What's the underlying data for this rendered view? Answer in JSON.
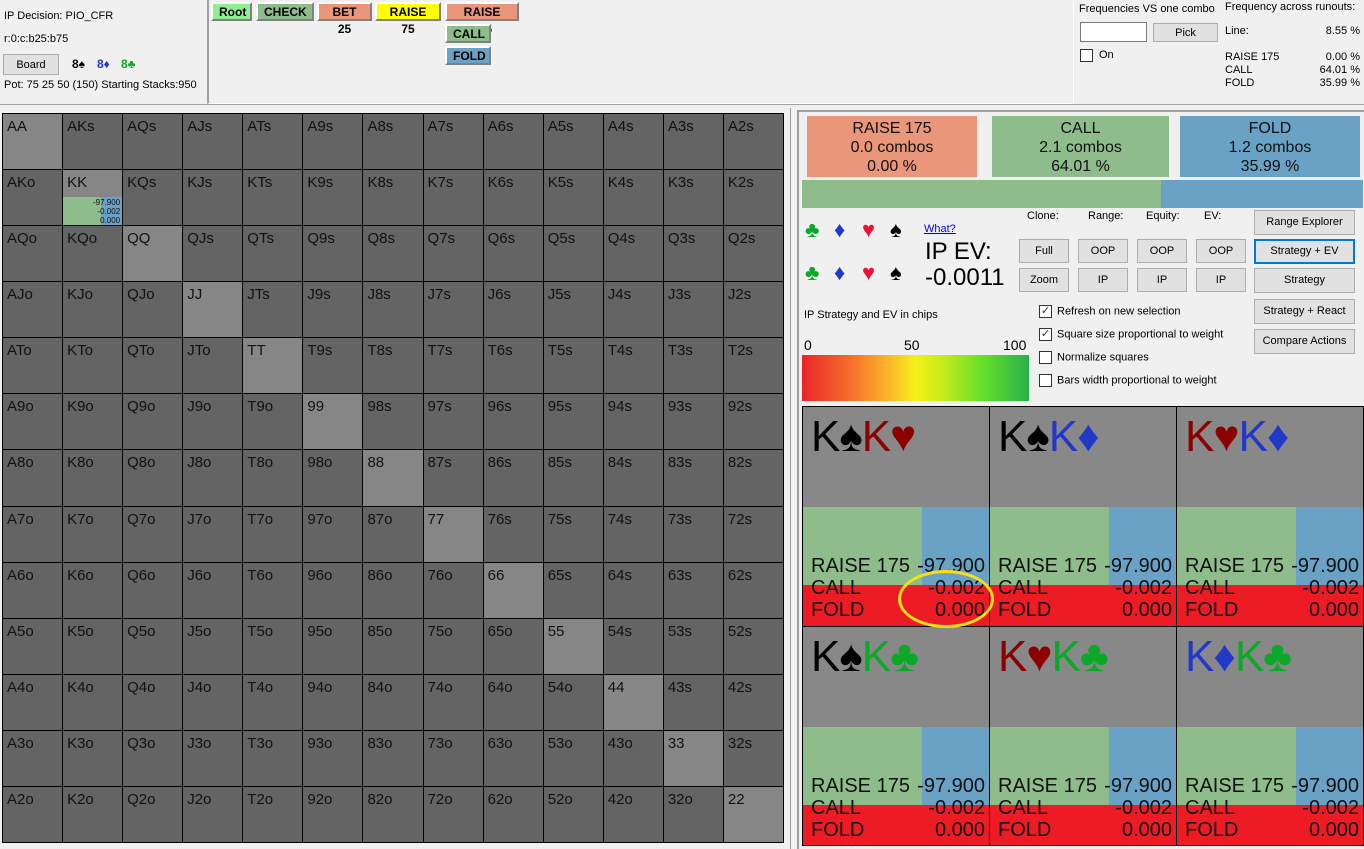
{
  "info": {
    "decision": "IP Decision:  PIO_CFR",
    "line": "r:0:c:b25:b75",
    "board_button": "Board",
    "board_cards": [
      {
        "text": "8♠",
        "suit": "spade"
      },
      {
        "text": "8♦",
        "suit": "diamond"
      },
      {
        "text": "8♣",
        "suit": "club"
      }
    ],
    "pot": "Pot: 75 25 50 (150) Starting Stacks:950"
  },
  "tree": {
    "nodes": [
      {
        "label": "Root",
        "color": "#90ee90"
      },
      {
        "label": "CHECK",
        "color": "#8fbc8b"
      },
      {
        "label": "BET 25",
        "color": "#e9967a"
      },
      {
        "label": "RAISE 75",
        "color": "#ffff00"
      },
      {
        "label": "RAISE 175",
        "color": "#e9967a"
      },
      {
        "label": "CALL",
        "color": "#8fbc8b"
      },
      {
        "label": "FOLD",
        "color": "#6aa2c6"
      }
    ]
  },
  "freq_combo": {
    "title": "Frequencies VS one combo",
    "input_value": "",
    "pick_label": "Pick",
    "on_label": "On",
    "on_checked": false
  },
  "runouts": {
    "title": "Frequency across runouts:",
    "line_label": "Line:",
    "line_value": "8.55 %",
    "rows": [
      {
        "label": "RAISE 175",
        "value": "0.00 %"
      },
      {
        "label": "CALL",
        "value": "64.01 %"
      },
      {
        "label": "FOLD",
        "value": "35.99 %"
      }
    ]
  },
  "grid": {
    "rows": [
      [
        "AA",
        "AKs",
        "AQs",
        "AJs",
        "ATs",
        "A9s",
        "A8s",
        "A7s",
        "A6s",
        "A5s",
        "A4s",
        "A3s",
        "A2s"
      ],
      [
        "AKo",
        "KK",
        "KQs",
        "KJs",
        "KTs",
        "K9s",
        "K8s",
        "K7s",
        "K6s",
        "K5s",
        "K4s",
        "K3s",
        "K2s"
      ],
      [
        "AQo",
        "KQo",
        "QQ",
        "QJs",
        "QTs",
        "Q9s",
        "Q8s",
        "Q7s",
        "Q6s",
        "Q5s",
        "Q4s",
        "Q3s",
        "Q2s"
      ],
      [
        "AJo",
        "KJo",
        "QJo",
        "JJ",
        "JTs",
        "J9s",
        "J8s",
        "J7s",
        "J6s",
        "J5s",
        "J4s",
        "J3s",
        "J2s"
      ],
      [
        "ATo",
        "KTo",
        "QTo",
        "JTo",
        "TT",
        "T9s",
        "T8s",
        "T7s",
        "T6s",
        "T5s",
        "T4s",
        "T3s",
        "T2s"
      ],
      [
        "A9o",
        "K9o",
        "Q9o",
        "J9o",
        "T9o",
        "99",
        "98s",
        "97s",
        "96s",
        "95s",
        "94s",
        "93s",
        "92s"
      ],
      [
        "A8o",
        "K8o",
        "Q8o",
        "J8o",
        "T8o",
        "98o",
        "88",
        "87s",
        "86s",
        "85s",
        "84s",
        "83s",
        "82s"
      ],
      [
        "A7o",
        "K7o",
        "Q7o",
        "J7o",
        "T7o",
        "97o",
        "87o",
        "77",
        "76s",
        "75s",
        "74s",
        "73s",
        "72s"
      ],
      [
        "A6o",
        "K6o",
        "Q6o",
        "J6o",
        "T6o",
        "96o",
        "86o",
        "76o",
        "66",
        "65s",
        "64s",
        "63s",
        "62s"
      ],
      [
        "A5o",
        "K5o",
        "Q5o",
        "J5o",
        "T5o",
        "95o",
        "85o",
        "75o",
        "65o",
        "55",
        "54s",
        "53s",
        "52s"
      ],
      [
        "A4o",
        "K4o",
        "Q4o",
        "J4o",
        "T4o",
        "94o",
        "84o",
        "74o",
        "64o",
        "54o",
        "44",
        "43s",
        "42s"
      ],
      [
        "A3o",
        "K3o",
        "Q3o",
        "J3o",
        "T3o",
        "93o",
        "83o",
        "73o",
        "63o",
        "53o",
        "43o",
        "33",
        "32s"
      ],
      [
        "A2o",
        "K2o",
        "Q2o",
        "J2o",
        "T2o",
        "92o",
        "82o",
        "72o",
        "62o",
        "52o",
        "42o",
        "32o",
        "22"
      ]
    ],
    "active_hand": "KK",
    "active_ev": [
      "-97.900",
      "-0.002",
      "0.000"
    ]
  },
  "summary": {
    "actions": [
      {
        "label": "RAISE 175",
        "combos": "0.0 combos",
        "pct": "0.00 %",
        "color": "#e9967a"
      },
      {
        "label": "CALL",
        "combos": "2.1 combos",
        "pct": "64.01 %",
        "color": "#8fbc8b"
      },
      {
        "label": "FOLD",
        "combos": "1.2 combos",
        "pct": "35.99 %",
        "color": "#6aa2c6"
      }
    ],
    "bar": [
      {
        "action": "CALL",
        "fraction": 0.6401,
        "color": "#8fbc8b"
      },
      {
        "action": "FOLD",
        "fraction": 0.3599,
        "color": "#6aa2c6"
      }
    ]
  },
  "suits": {
    "row1": [
      {
        "glyph": "♣",
        "color": "#0ca82a",
        "name": "club"
      },
      {
        "glyph": "♦",
        "color": "#2238c8",
        "name": "diamond"
      },
      {
        "glyph": "♥",
        "color": "#ee1133",
        "name": "heart"
      },
      {
        "glyph": "♠",
        "color": "#000000",
        "name": "spade"
      }
    ],
    "row2": [
      {
        "glyph": "♣",
        "color": "#0ca82a",
        "name": "club"
      },
      {
        "glyph": "♦",
        "color": "#2238c8",
        "name": "diamond"
      },
      {
        "glyph": "♥",
        "color": "#ee1133",
        "name": "heart"
      },
      {
        "glyph": "♠",
        "color": "#000000",
        "name": "spade"
      }
    ]
  },
  "ev": {
    "what_link": "What?",
    "label": "IP EV:",
    "value": "-0.0011"
  },
  "controls": {
    "clone_label": "Clone:",
    "range_label": "Range:",
    "equity_label": "Equity:",
    "ev_label": "EV:",
    "full": "Full",
    "zoom": "Zoom",
    "oop": "OOP",
    "ip": "IP",
    "range_explorer": "Range Explorer",
    "strategy_ev": "Strategy + EV",
    "strategy": "Strategy",
    "strategy_react": "Strategy + React",
    "compare_actions": "Compare Actions",
    "checkboxes": [
      {
        "label": "Refresh on new selection",
        "checked": true
      },
      {
        "label": "Square size proportional to weight",
        "checked": true
      },
      {
        "label": "Normalize squares",
        "checked": false
      },
      {
        "label": "Bars width proportional to weight",
        "checked": false
      }
    ]
  },
  "legend": {
    "title": "IP Strategy and EV in chips",
    "scale": [
      "0",
      "50",
      "100"
    ]
  },
  "combos": [
    {
      "cards": [
        {
          "rank": "K",
          "suit": "♠",
          "color": "#000000"
        },
        {
          "rank": "K",
          "suit": "♥",
          "color": "#8b0000"
        }
      ],
      "call_fraction": 0.64,
      "fold_fraction": 0.36,
      "ev": [
        {
          "action": "RAISE 175",
          "value": "-97.900"
        },
        {
          "action": "CALL",
          "value": "-0.002"
        },
        {
          "action": "FOLD",
          "value": "0.000"
        }
      ]
    },
    {
      "cards": [
        {
          "rank": "K",
          "suit": "♠",
          "color": "#000000"
        },
        {
          "rank": "K",
          "suit": "♦",
          "color": "#2238c8"
        }
      ],
      "call_fraction": 0.64,
      "fold_fraction": 0.36,
      "ev": [
        {
          "action": "RAISE 175",
          "value": "-97.900"
        },
        {
          "action": "CALL",
          "value": "-0.002"
        },
        {
          "action": "FOLD",
          "value": "0.000"
        }
      ]
    },
    {
      "cards": [
        {
          "rank": "K",
          "suit": "♥",
          "color": "#8b0000"
        },
        {
          "rank": "K",
          "suit": "♦",
          "color": "#2238c8"
        }
      ],
      "call_fraction": 0.64,
      "fold_fraction": 0.36,
      "ev": [
        {
          "action": "RAISE 175",
          "value": "-97.900"
        },
        {
          "action": "CALL",
          "value": "-0.002"
        },
        {
          "action": "FOLD",
          "value": "0.000"
        }
      ]
    },
    {
      "cards": [
        {
          "rank": "K",
          "suit": "♠",
          "color": "#000000"
        },
        {
          "rank": "K",
          "suit": "♣",
          "color": "#0ca82a"
        }
      ],
      "call_fraction": 0.64,
      "fold_fraction": 0.36,
      "ev": [
        {
          "action": "RAISE 175",
          "value": "-97.900"
        },
        {
          "action": "CALL",
          "value": "-0.002"
        },
        {
          "action": "FOLD",
          "value": "0.000"
        }
      ]
    },
    {
      "cards": [
        {
          "rank": "K",
          "suit": "♥",
          "color": "#8b0000"
        },
        {
          "rank": "K",
          "suit": "♣",
          "color": "#0ca82a"
        }
      ],
      "call_fraction": 0.64,
      "fold_fraction": 0.36,
      "ev": [
        {
          "action": "RAISE 175",
          "value": "-97.900"
        },
        {
          "action": "CALL",
          "value": "-0.002"
        },
        {
          "action": "FOLD",
          "value": "0.000"
        }
      ]
    },
    {
      "cards": [
        {
          "rank": "K",
          "suit": "♦",
          "color": "#2238c8"
        },
        {
          "rank": "K",
          "suit": "♣",
          "color": "#0ca82a"
        }
      ],
      "call_fraction": 0.64,
      "fold_fraction": 0.36,
      "ev": [
        {
          "action": "RAISE 175",
          "value": "-97.900"
        },
        {
          "action": "CALL",
          "value": "-0.002"
        },
        {
          "action": "FOLD",
          "value": "0.000"
        }
      ]
    }
  ],
  "colors": {
    "raise": "#e9967a",
    "call": "#8fbc8b",
    "fold": "#6aa2c6",
    "ev_red": "#ed1c24",
    "annotation": "#f5e11a"
  }
}
